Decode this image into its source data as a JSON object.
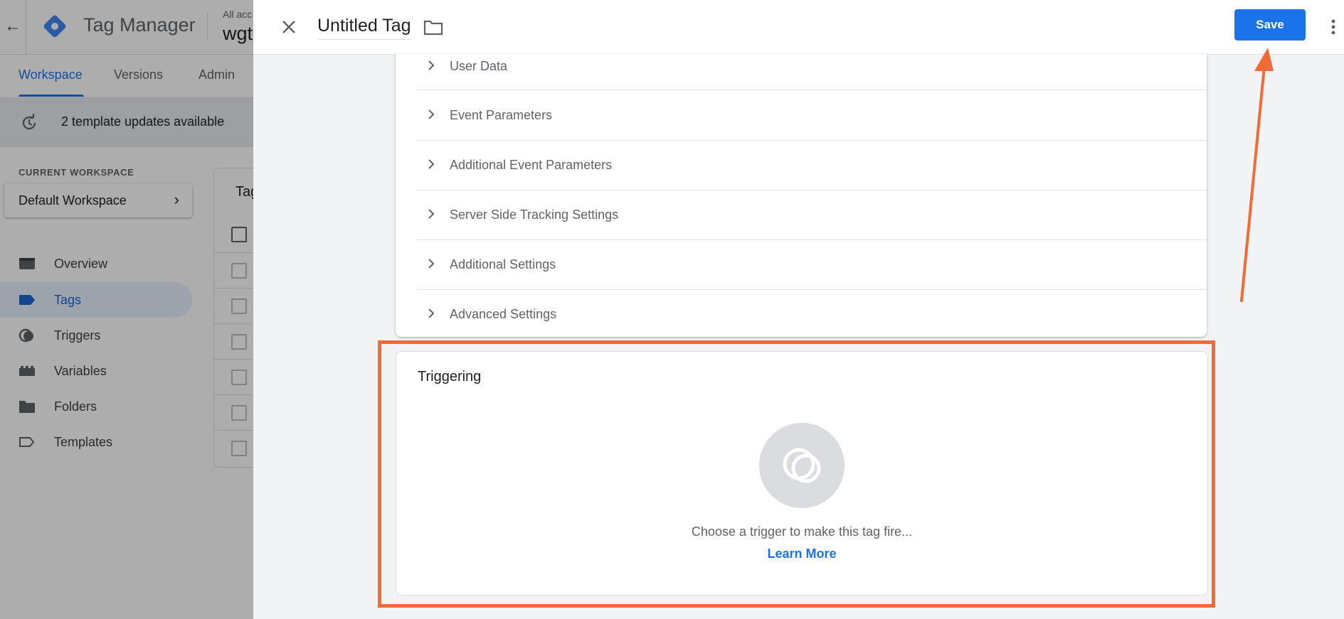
{
  "background_app": {
    "app_title": "Tag Manager",
    "account_label": "All acc",
    "container_name": "wgt",
    "tabs": [
      {
        "label": "Workspace",
        "active": true
      },
      {
        "label": "Versions",
        "active": false
      },
      {
        "label": "Admin",
        "active": false
      }
    ],
    "update_banner": {
      "text": "2 template updates available",
      "icon": "refresh-icon"
    },
    "current_workspace_label": "CURRENT WORKSPACE",
    "workspace_name": "Default Workspace",
    "sidebar": [
      {
        "label": "Overview",
        "icon": "overview-icon",
        "active": false
      },
      {
        "label": "Tags",
        "icon": "tag-icon",
        "active": true
      },
      {
        "label": "Triggers",
        "icon": "trigger-icon",
        "active": false
      },
      {
        "label": "Variables",
        "icon": "variables-icon",
        "active": false
      },
      {
        "label": "Folders",
        "icon": "folder-icon",
        "active": false
      },
      {
        "label": "Templates",
        "icon": "template-icon",
        "active": false
      }
    ],
    "tags_card_title": "Tag"
  },
  "editor": {
    "tag_name": "Untitled Tag",
    "save_label": "Save",
    "config_sections": [
      "User Data",
      "Event Parameters",
      "Additional Event Parameters",
      "Server Side Tracking Settings",
      "Additional Settings",
      "Advanced Settings"
    ],
    "triggering": {
      "title": "Triggering",
      "hint": "Choose a trigger to make this tag fire...",
      "learn_more": "Learn More"
    }
  },
  "colors": {
    "accent": "#1a73e8",
    "annotation": "#f26b36"
  }
}
